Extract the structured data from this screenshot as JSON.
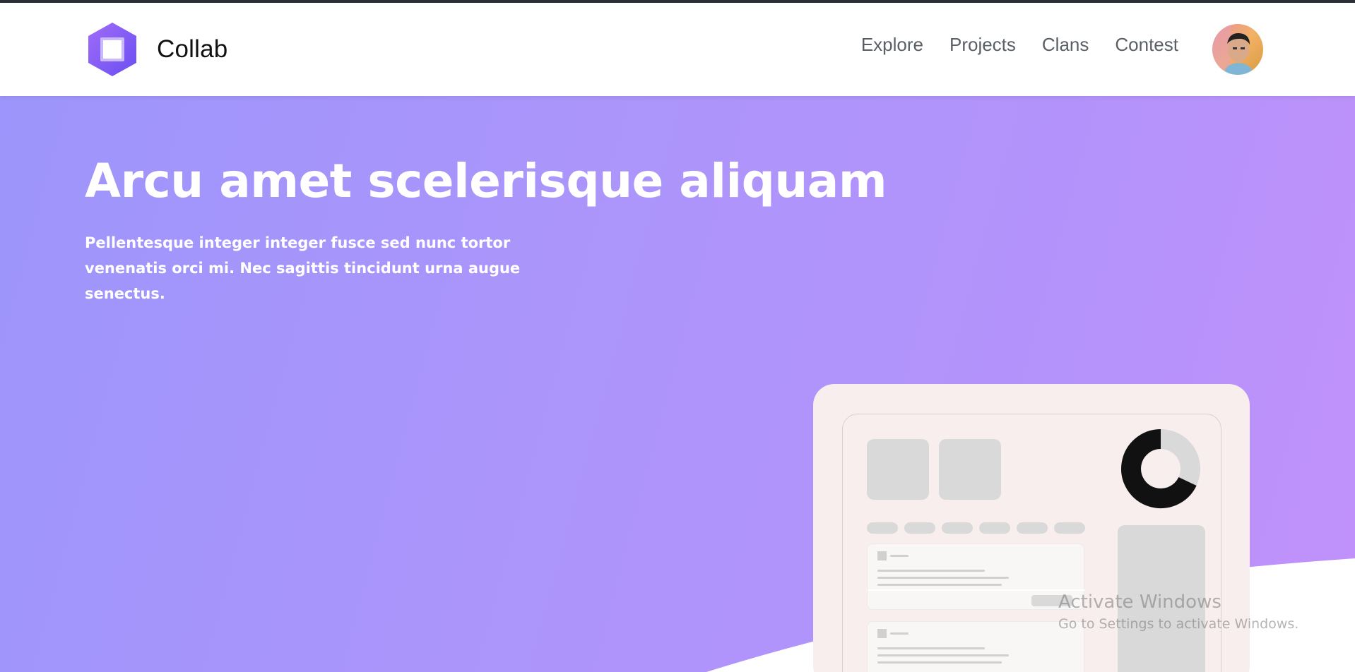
{
  "header": {
    "brand_name": "Collab",
    "logo_icon": "hexagon-logo-icon",
    "nav": [
      {
        "label": "Explore"
      },
      {
        "label": "Projects"
      },
      {
        "label": "Clans"
      },
      {
        "label": "Contest"
      }
    ],
    "avatar_icon": "user-avatar"
  },
  "hero": {
    "title": "Arcu amet scelerisque aliquam",
    "subtitle": "Pellentesque integer integer fusce sed nunc tortor venenatis orci mi. Nec sagittis tincidunt urna augue senectus."
  },
  "watermark": {
    "title": "Activate Windows",
    "subtitle": "Go to Settings to activate Windows."
  },
  "colors": {
    "gradient_start": "#9d95fb",
    "gradient_end": "#c191fa",
    "brand_purple": "#8b5cf6",
    "topbar": "#2d2f36",
    "mockup_bg": "#f8eeee"
  }
}
